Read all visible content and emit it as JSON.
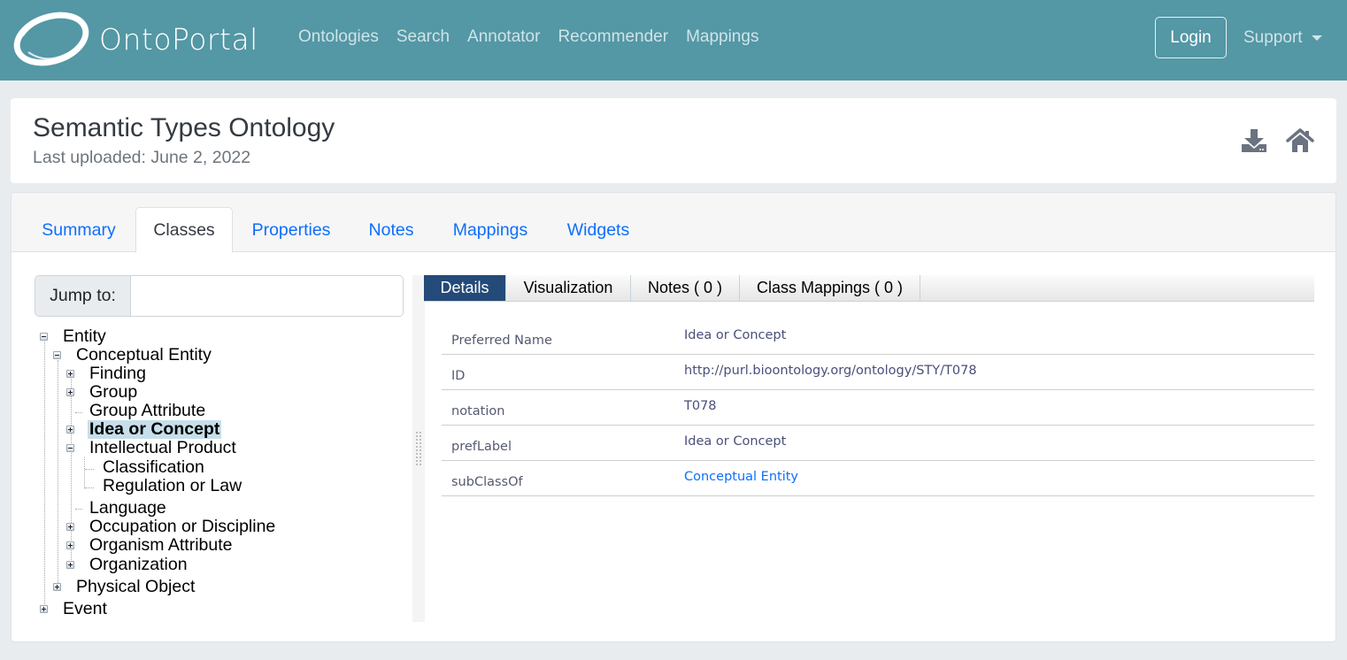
{
  "navbar": {
    "brand": "OntoPortal",
    "links": [
      "Ontologies",
      "Search",
      "Annotator",
      "Recommender",
      "Mappings"
    ],
    "login_label": "Login",
    "support_label": "Support",
    "background_color": "#5497a5"
  },
  "header": {
    "title": "Semantic Types Ontology",
    "subtitle": "Last uploaded: June 2, 2022",
    "icons": [
      "download-icon",
      "home-icon"
    ]
  },
  "tabs": [
    {
      "label": "Summary",
      "active": false
    },
    {
      "label": "Classes",
      "active": true
    },
    {
      "label": "Properties",
      "active": false
    },
    {
      "label": "Notes",
      "active": false
    },
    {
      "label": "Mappings",
      "active": false
    },
    {
      "label": "Widgets",
      "active": false
    }
  ],
  "jump_to": {
    "label": "Jump to:",
    "value": "",
    "placeholder": ""
  },
  "tree": [
    {
      "label": "Entity",
      "level": 0,
      "toggle": "minus"
    },
    {
      "label": "Conceptual Entity",
      "level": 1,
      "toggle": "minus"
    },
    {
      "label": "Finding",
      "level": 2,
      "toggle": "plus"
    },
    {
      "label": "Group",
      "level": 2,
      "toggle": "plus"
    },
    {
      "label": "Group Attribute",
      "level": 2,
      "toggle": "none"
    },
    {
      "label": "Idea or Concept",
      "level": 2,
      "toggle": "plus",
      "selected": true
    },
    {
      "label": "Intellectual Product",
      "level": 2,
      "toggle": "minus"
    },
    {
      "label": "Classification",
      "level": 3,
      "toggle": "none"
    },
    {
      "label": "Regulation or Law",
      "level": 3,
      "toggle": "none"
    },
    {
      "label": "Language",
      "level": 2,
      "toggle": "none"
    },
    {
      "label": "Occupation or Discipline",
      "level": 2,
      "toggle": "plus"
    },
    {
      "label": "Organism Attribute",
      "level": 2,
      "toggle": "plus"
    },
    {
      "label": "Organization",
      "level": 2,
      "toggle": "plus"
    },
    {
      "label": "Physical Object",
      "level": 1,
      "toggle": "plus"
    },
    {
      "label": "Event",
      "level": 0,
      "toggle": "plus"
    }
  ],
  "panel_tabs": [
    {
      "label": "Details",
      "active": true
    },
    {
      "label": "Visualization",
      "active": false
    },
    {
      "label": "Notes ( 0 )",
      "active": false
    },
    {
      "label": "Class Mappings ( 0 )",
      "active": false
    }
  ],
  "details": [
    {
      "key": "Preferred Name",
      "value": "Idea or Concept",
      "link": false
    },
    {
      "key": "ID",
      "value": "http://purl.bioontology.org/ontology/STY/T078",
      "link": false
    },
    {
      "key": "notation",
      "value": "T078",
      "link": false
    },
    {
      "key": "prefLabel",
      "value": "Idea or Concept",
      "link": false
    },
    {
      "key": "subClassOf",
      "value": "Conceptual Entity",
      "link": true
    }
  ]
}
